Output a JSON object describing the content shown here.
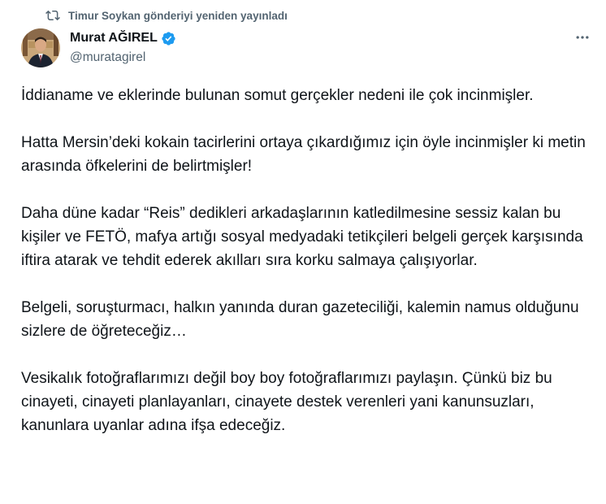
{
  "repost": {
    "icon": "repost-icon",
    "text": "Timur Soykan gönderiyi yeniden yayınladı"
  },
  "author": {
    "display_name": "Murat AĞIREL",
    "handle": "@muratagirel",
    "verified": true,
    "verified_color": "#1d9bf0",
    "avatar_icon": "avatar-photo"
  },
  "more_icon": "more-icon",
  "tweet": {
    "paragraphs": [
      "İddianame ve eklerinde bulunan somut gerçekler nedeni ile çok incinmişler.",
      "Hatta Mersin’deki kokain tacirlerini ortaya çıkardığımız için öyle incinmişler ki metin arasında öfkelerini de belirtmişler!",
      "Daha düne kadar “Reis” dedikleri arkadaşlarının katledilmesine sessiz kalan bu kişiler ve FETÖ, mafya artığı sosyal medyadaki tetikçileri belgeli gerçek karşısında iftira atarak ve tehdit ederek akılları sıra korku salmaya çalışıyorlar.",
      "Belgeli, soruşturmacı, halkın yanında duran gazeteciliği, kalemin namus olduğunu sizlere de öğreteceğiz…",
      "Vesikalık fotoğraflarımızı değil boy boy fotoğraflarımızı paylaşın. Çünkü biz bu cinayeti, cinayeti planlayanları, cinayete destek verenleri yani kanunsuzları, kanunlara uyanlar adına ifşa edeceğiz."
    ]
  },
  "colors": {
    "text_primary": "#0f1419",
    "text_secondary": "#536471",
    "background": "#ffffff"
  }
}
